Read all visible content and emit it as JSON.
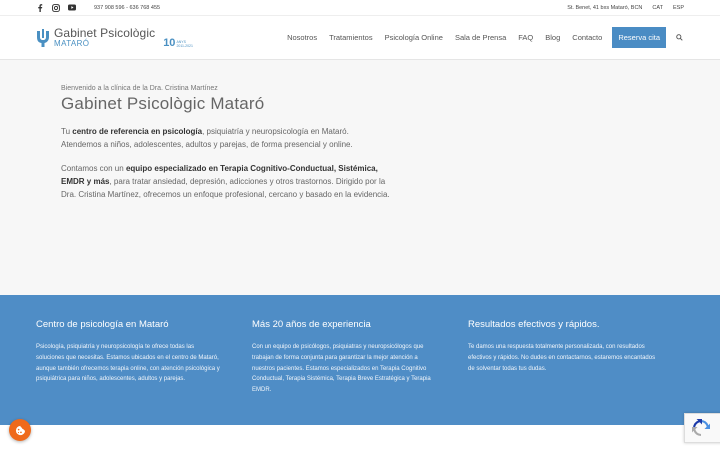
{
  "topbar": {
    "social": [
      {
        "icon": "facebook-icon"
      },
      {
        "icon": "instagram-icon"
      },
      {
        "icon": "youtube-icon"
      }
    ],
    "phone": "937 908 596 - 636 768 455",
    "address": "St. Benet, 41 bxs Mataró, BCN",
    "lang_cat": "CAT",
    "lang_esp": "ESP"
  },
  "logo": {
    "title": "Gabinet Psicològic",
    "subtitle": "MATARÓ",
    "years_num": "10",
    "years_label": "ANYS",
    "years_range": "2011-2021",
    "brand_color": "#4a90c2"
  },
  "nav": {
    "items": [
      "Nosotros",
      "Tratamientos",
      "Psicología Online",
      "Sala de Prensa",
      "FAQ",
      "Blog",
      "Contacto"
    ],
    "cta": "Reserva cita",
    "search_icon": "search-icon"
  },
  "hero": {
    "welcome": "Bienvenido a la clínica de la Dra. Cristina Martínez",
    "title": "Gabinet Psicològic Mataró",
    "p1": [
      {
        "text": "Tu ",
        "bold": false
      },
      {
        "text": "centro de referencia en psicología",
        "bold": true
      },
      {
        "text": ", psiquiatría y neuropsicología en Mataró. Atendemos a niños, adolescentes, adultos y parejas, de forma presencial y online.",
        "bold": false
      }
    ],
    "p2": [
      {
        "text": "Contamos con un ",
        "bold": false
      },
      {
        "text": "equipo especializado en Terapia Cognitivo-Conductual, Sistémica, EMDR y más",
        "bold": true
      },
      {
        "text": ", para tratar ansiedad, depresión, adicciones y otros trastornos. Dirigido por la Dra. Cristina Martínez, ofrecemos un enfoque profesional, cercano y basado en la evidencia.",
        "bold": false
      }
    ]
  },
  "features": [
    {
      "title": "Centro de psicología en Mataró",
      "text": "Psicología, psiquiatría y neuropsicología te ofrece todas las soluciones que necesitas. Estamos ubicados en el centro de Mataró, aunque también ofrecemos terapia online, con atención psicológica y psiquiátrica para niños, adolescentes, adultos y parejas."
    },
    {
      "title": "Más 20 años de experiencia",
      "text": "Con un equipo de psicólogos, psiquiatras y neuropsicólogos que trabajan de forma conjunta para garantizar la mejor atención a nuestros pacientes. Estamos especializados en Terapia Cognitivo Conductual, Terapia Sistémica, Terapia Breve Estratégica y Terapia EMDR."
    },
    {
      "title": "Resultados efectivos y rápidos.",
      "text": "Te damos una respuesta totalmente personalizada, con resultados efectivos y rápidos. No dudes en contactarnos, estaremos encantados de solventar todas tus dudas."
    }
  ],
  "colors": {
    "accent": "#4f8dc6",
    "cta": "#4a8cc4",
    "cookie": "#ef6a1c"
  },
  "widgets": {
    "cookie_icon": "cookie-icon",
    "captcha_icon": "recaptcha-icon"
  }
}
